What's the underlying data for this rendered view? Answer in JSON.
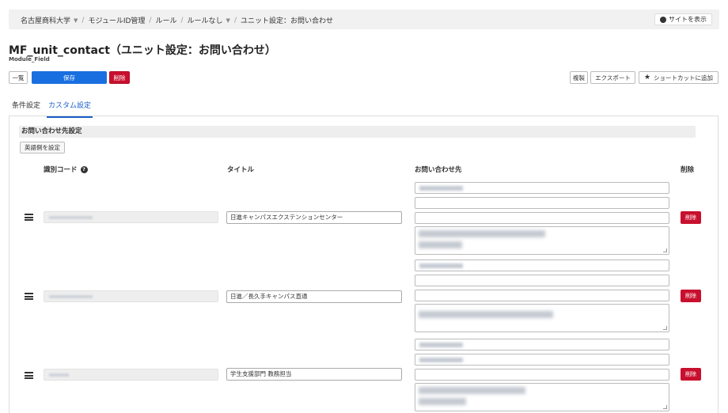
{
  "breadcrumb": {
    "items": [
      "名古屋商科大学",
      "モジュールID管理",
      "ルール",
      "ルールなし",
      "ユニット設定：お問い合わせ"
    ],
    "view_site": "サイトを表示"
  },
  "page": {
    "title": "MF_unit_contact（ユニット設定：お問い合わせ）",
    "subtitle": "Module_Field"
  },
  "toolbar": {
    "list": "一覧",
    "save": "保存",
    "delete": "削除",
    "duplicate": "複製",
    "export": "エクスポート",
    "shortcut": "ショートカットに追加"
  },
  "tabs": [
    "条件設定",
    "カスタム設定"
  ],
  "section": {
    "title": "お問い合わせ先設定",
    "english_button": "英語側を設定",
    "columns": {
      "code": "識別コード",
      "title": "タイトル",
      "contact": "お問い合わせ先",
      "delete": "削除"
    }
  },
  "rows": [
    {
      "title": "日進キャンパスエクステンションセンター",
      "delete": "削除"
    },
    {
      "title": "日進／長久手キャンパス直通",
      "delete": "削除"
    },
    {
      "title": "学生支援部門 教務担当",
      "delete": "削除"
    }
  ],
  "colors": {
    "primary": "#1a6fe0",
    "danger": "#c8102e",
    "tab_active": "#1a5fc7"
  }
}
